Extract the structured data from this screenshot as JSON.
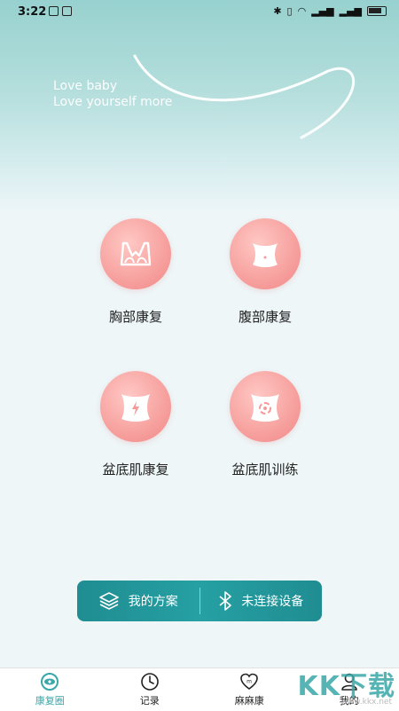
{
  "status_bar": {
    "time": "3:22"
  },
  "header": {
    "tagline_line1": "Love baby",
    "tagline_line2": "Love yourself more"
  },
  "features": [
    {
      "label": "胸部康复",
      "icon": "bra-icon"
    },
    {
      "label": "腹部康复",
      "icon": "abdomen-icon"
    },
    {
      "label": "盆底肌康复",
      "icon": "pelvic-energy-icon"
    },
    {
      "label": "盆底肌训练",
      "icon": "pelvic-training-icon"
    }
  ],
  "action_bar": {
    "plan_label": "我的方案",
    "device_label": "未连接设备"
  },
  "tabs": [
    {
      "label": "康复圈",
      "icon": "eye-circle-icon",
      "active": true
    },
    {
      "label": "记录",
      "icon": "clock-icon",
      "active": false
    },
    {
      "label": "麻麻康",
      "icon": "heart-icon",
      "active": false
    },
    {
      "label": "我的",
      "icon": "user-icon",
      "active": false
    }
  ],
  "watermark": {
    "text": "KK下载",
    "url_text": "www.kkx.net"
  },
  "colors": {
    "accent": "#26a0a3",
    "circle_pink": "#f59a98",
    "header_teal": "#97d1cf"
  }
}
